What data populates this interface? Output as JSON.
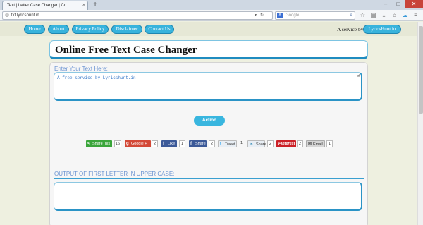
{
  "browser": {
    "tab_title": "Text | Letter Case Changer | Co...",
    "tab_close": "×",
    "new_tab": "+",
    "win_min": "–",
    "win_max": "□",
    "win_close": "✕",
    "url": "txt.lyricshunt.in",
    "search_engine_badge": "8",
    "search_placeholder": "Google"
  },
  "nav": {
    "items": [
      "Home",
      "About",
      "Privacy Policy",
      "Disclaimer",
      "Contact Us"
    ],
    "service_prefix": "A service by",
    "service_link": "LyricsHunt.in"
  },
  "page": {
    "title": "Online Free Text Case Changer",
    "input_label": "Enter Your Text Here:",
    "input_value": "A free service by Lyricshunt.in",
    "action_label": "Action",
    "output_label": "OUTPUT OF FIRST LETTER IN UPPER CASE:"
  },
  "share": [
    {
      "label": "ShareThis",
      "count": "16",
      "color": "#3aa53a",
      "icon": "share-icon",
      "glyph": "<"
    },
    {
      "label": "Google +",
      "count": "2",
      "color": "#d34836",
      "icon": "google-plus-icon",
      "glyph": "g"
    },
    {
      "label": "Like",
      "count": "1",
      "color": "#3b5998",
      "icon": "facebook-icon",
      "glyph": "f"
    },
    {
      "label": "Share",
      "count": "2",
      "color": "#3b5998",
      "icon": "facebook-icon",
      "glyph": "f"
    },
    {
      "label": "Tweet",
      "count": "1",
      "color": "#e8eef4",
      "icon": "twitter-icon",
      "glyph": "t"
    },
    {
      "label": "Share",
      "count": "2",
      "color": "#e8eef4",
      "icon": "linkedin-icon",
      "glyph": "in"
    },
    {
      "label": "Pinterest",
      "count": "2",
      "color": "#cb2027",
      "icon": "pinterest-icon",
      "glyph": ""
    },
    {
      "label": "Email",
      "count": "1",
      "color": "#d6d6d6",
      "icon": "email-icon",
      "glyph": "✉"
    }
  ]
}
